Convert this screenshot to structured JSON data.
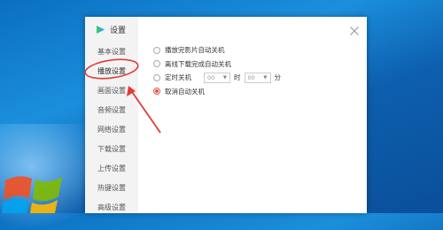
{
  "dialog": {
    "title": "设置",
    "nav": [
      {
        "label": "基本设置"
      },
      {
        "label": "播放设置"
      },
      {
        "label": "画面设置"
      },
      {
        "label": "音频设置"
      },
      {
        "label": "网络设置"
      },
      {
        "label": "下载设置"
      },
      {
        "label": "上传设置"
      },
      {
        "label": "热键设置"
      },
      {
        "label": "高级设置"
      }
    ],
    "active_nav": "播放设置",
    "options": {
      "opt1": "播放完影片自动关机",
      "opt2": "离线下载完成自动关机",
      "opt3": "定时关机",
      "opt4": "取消自动关机",
      "hour_value": "00",
      "hour_unit": "时",
      "minute_value": "00",
      "minute_unit": "分",
      "selected": "取消自动关机"
    }
  },
  "colors": {
    "accent_red": "#e0554a",
    "desktop_blue": "#1b8fdc"
  }
}
